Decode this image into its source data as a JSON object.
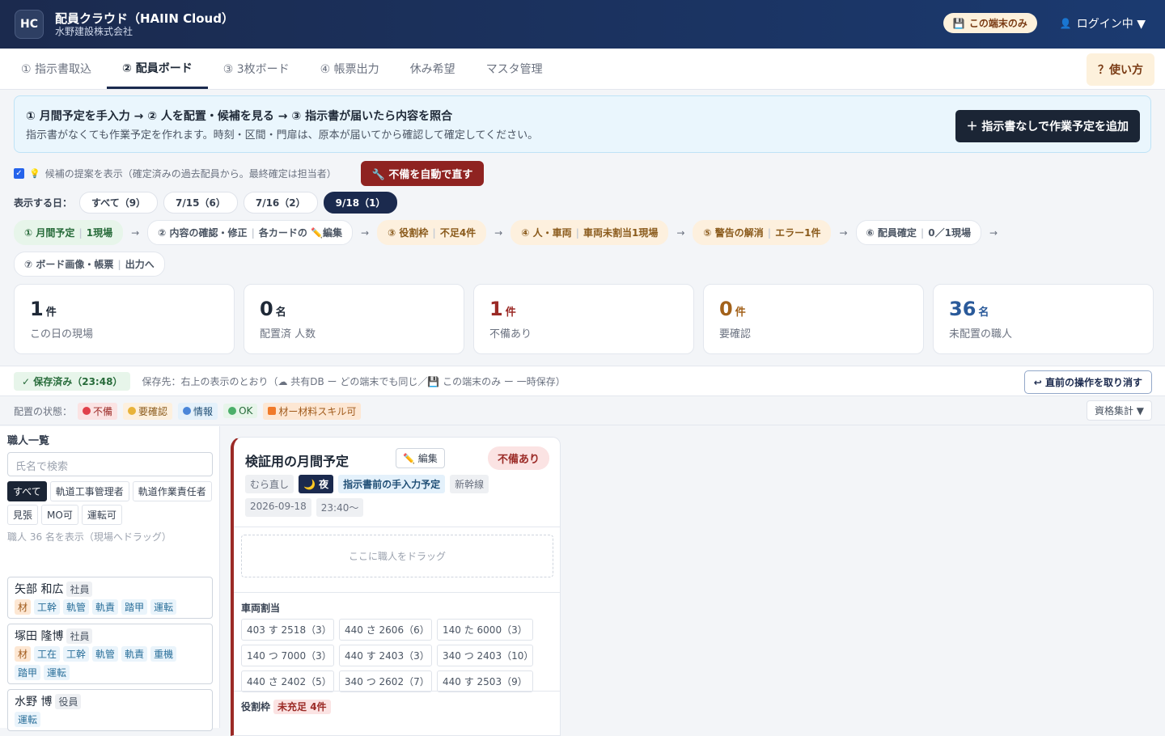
{
  "header": {
    "logo": "HC",
    "app_title": "配員クラウド（HAIIN Cloud）",
    "company": "水野建設株式会社",
    "device_badge": "この端末のみ",
    "device_icon": "💾",
    "login": "ログイン中 ▼",
    "user_icon": "👤"
  },
  "nav": {
    "tabs": [
      "① 指示書取込",
      "② 配員ボード",
      "③ 3枚ボード",
      "④ 帳票出力",
      "休み希望",
      "マスタ管理"
    ],
    "help": "？使い方"
  },
  "banner": {
    "line1": "① 月間予定を手入力 → ② 人を配置・候補を見る → ③ 指示書が届いたら内容を照合",
    "line2": "指示書がなくても作業予定を作れます。時刻・区間・門扉は、原本が届いてから確認して確定してください。",
    "add_button": "＋ 指示書なしで作業予定を追加"
  },
  "suggest": {
    "icon": "💡",
    "label": "候補の提案を表示（確定済みの過去配員から。最終確定は担当者）",
    "autofix": "🔧 不備を自動で直す"
  },
  "days": {
    "label": "表示する日：",
    "chips": [
      "すべて（9）",
      "7/15（6）",
      "7/16（2）",
      "9/18（1）"
    ]
  },
  "steps": [
    {
      "a": "① 月間予定",
      "b": "1現場"
    },
    {
      "a": "② 内容の確認・修正",
      "b": "各カードの ✏️編集"
    },
    {
      "a": "③ 役割枠",
      "b": "不足4件"
    },
    {
      "a": "④ 人・車両",
      "b": "車両未割当1現場"
    },
    {
      "a": "⑤ 警告の解消",
      "b": "エラー1件"
    },
    {
      "a": "⑥ 配員確定",
      "b": "0／1現場"
    },
    {
      "a": "⑦ ボード画像・帳票",
      "b": "出力へ"
    }
  ],
  "arrow": "→",
  "stats": [
    {
      "n": "1",
      "u": "件",
      "d": "この日の現場",
      "c": "#1f2937"
    },
    {
      "n": "0",
      "u": "名",
      "d": "配置済 人数",
      "c": "#1f2937"
    },
    {
      "n": "1",
      "u": "件",
      "d": "不備あり",
      "c": "#9b2a26"
    },
    {
      "n": "0",
      "u": "件",
      "d": "要確認",
      "c": "#a3621b"
    },
    {
      "n": "36",
      "u": "名",
      "d": "未配置の職人",
      "c": "#2a5a9a"
    }
  ],
  "save": {
    "status": "✓ 保存済み（23:48）",
    "note": "保存先：右上の表示のとおり（☁ 共有DB ー どの端末でも同じ／💾 この端末のみ ー 一時保存）",
    "undo": "↩ 直前の操作を取り消す"
  },
  "legend": {
    "label": "配置の状態：",
    "items": [
      "不備",
      "要確認",
      "情報",
      "OK",
      "材ー材料スキル可"
    ],
    "qual": "資格集計 ▼"
  },
  "colors": {
    "ng": "#e0404a",
    "warn": "#e8b33a",
    "info": "#4a86d9",
    "ok": "#4caf6a",
    "mat": "#f07a2a"
  },
  "workers": {
    "title": "職人一覧",
    "search_placeholder": "氏名で検索",
    "filters": [
      "すべて",
      "軌道工事管理者",
      "軌道作業責任者",
      "見張",
      "MO可",
      "運転可"
    ],
    "count": "職人 36 名を表示（現場へドラッグ）",
    "list": [
      {
        "name": "矢部 和広",
        "role": "社員",
        "tags": [
          "材",
          "工幹",
          "軌管",
          "軌責",
          "踏甲",
          "運転"
        ]
      },
      {
        "name": "塚田 隆博",
        "role": "社員",
        "tags": [
          "材",
          "工在",
          "工幹",
          "軌管",
          "軌責",
          "重機",
          "踏甲",
          "運転"
        ]
      },
      {
        "name": "水野 博",
        "role": "役員",
        "tags": [
          "運転"
        ]
      }
    ]
  },
  "board": {
    "title": "検証用の月間予定",
    "edit": "✏️ 編集",
    "flag": "不備あり",
    "meta": [
      "むら直し",
      "🌙 夜",
      "指示書前の手入力予定",
      "新幹線",
      "2026-09-18",
      "23:40〜"
    ],
    "drop": "ここに職人をドラッグ",
    "vehicle_title": "車両割当",
    "vehicles": [
      "403 す 2518（3）",
      "440 さ 2606（6）",
      "140 た 6000（3）",
      "140 つ 7000（3）",
      "440 す 2403（3）",
      "340 つ 2403（10）",
      "440 さ 2402（5）",
      "340 つ 2602（7）",
      "440 す 2503（9）"
    ],
    "roles_title": "役割枠",
    "roles_short": "未充足 4件"
  }
}
